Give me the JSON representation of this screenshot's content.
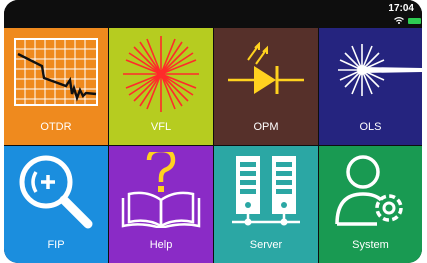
{
  "status": {
    "time": "17:04",
    "wifi_icon": "wifi-icon",
    "battery_icon": "battery-icon",
    "battery_color": "#2ecc52"
  },
  "tiles": [
    {
      "label": "OTDR",
      "icon": "otdr-trace-icon",
      "color": "#ef8a1e"
    },
    {
      "label": "VFL",
      "icon": "laser-burst-icon",
      "color": "#b6cc20"
    },
    {
      "label": "OPM",
      "icon": "photodiode-icon",
      "color": "#56302a"
    },
    {
      "label": "OLS",
      "icon": "light-source-icon",
      "color": "#25247f"
    },
    {
      "label": "FIP",
      "icon": "magnifier-icon",
      "color": "#1b8ede"
    },
    {
      "label": "Help",
      "icon": "book-question-icon",
      "color": "#8a2bc6"
    },
    {
      "label": "Server",
      "icon": "server-icon",
      "color": "#2ba7a4"
    },
    {
      "label": "System",
      "icon": "user-gear-icon",
      "color": "#199a52"
    }
  ]
}
